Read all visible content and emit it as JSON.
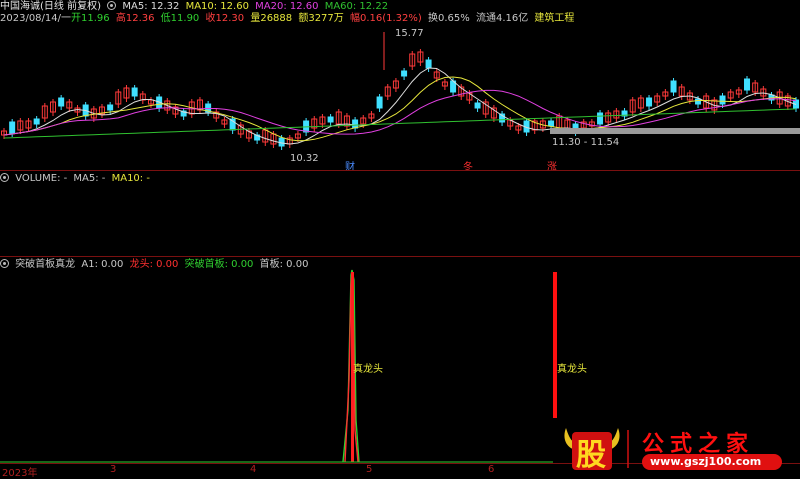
{
  "main_panel": {
    "title": "中国海诚(日线 前复权)",
    "ma5": "MA5: 12.32",
    "ma10": "MA10: 12.60",
    "ma20": "MA20: 12.60",
    "ma60": "MA60: 12.22",
    "date": "2023/08/14/一",
    "open": "开11.96",
    "high": "高12.36",
    "low": "低11.90",
    "close": "收12.30",
    "volume": "量26888",
    "amount": "额3277万",
    "change": "幅0.16(1.32%)",
    "turnover": "换0.65%",
    "float_cap": "流通4.16亿",
    "sector": "建筑工程",
    "peak_label": "15.77",
    "low_label": "10.32",
    "range_label": "11.30 - 11.54",
    "marker_cai": "财",
    "marker_dong": "冬",
    "marker_zhang": "涨",
    "colors": {
      "ma5": "#dcdcdc",
      "ma10": "#e6e63c",
      "ma20": "#e040e0",
      "ma60": "#30c030"
    }
  },
  "volume_panel": {
    "label": "VOLUME: -",
    "ma5": "MA5: -",
    "ma10": "MA10: -"
  },
  "indicator_panel": {
    "name": "突破首板真龙",
    "a1": "A1: 0.00",
    "longtou": "龙头: 0.00",
    "tupo": "突破首板: 0.00",
    "shouban": "首板: 0.00",
    "signal_label_1": "真龙头",
    "signal_label_2": "真龙头"
  },
  "time_axis": {
    "labels": [
      "2023年",
      "3",
      "4",
      "5",
      "6"
    ]
  },
  "watermark": {
    "badge": "股",
    "title": "公式之家",
    "url": "www.gszj100.com"
  }
}
